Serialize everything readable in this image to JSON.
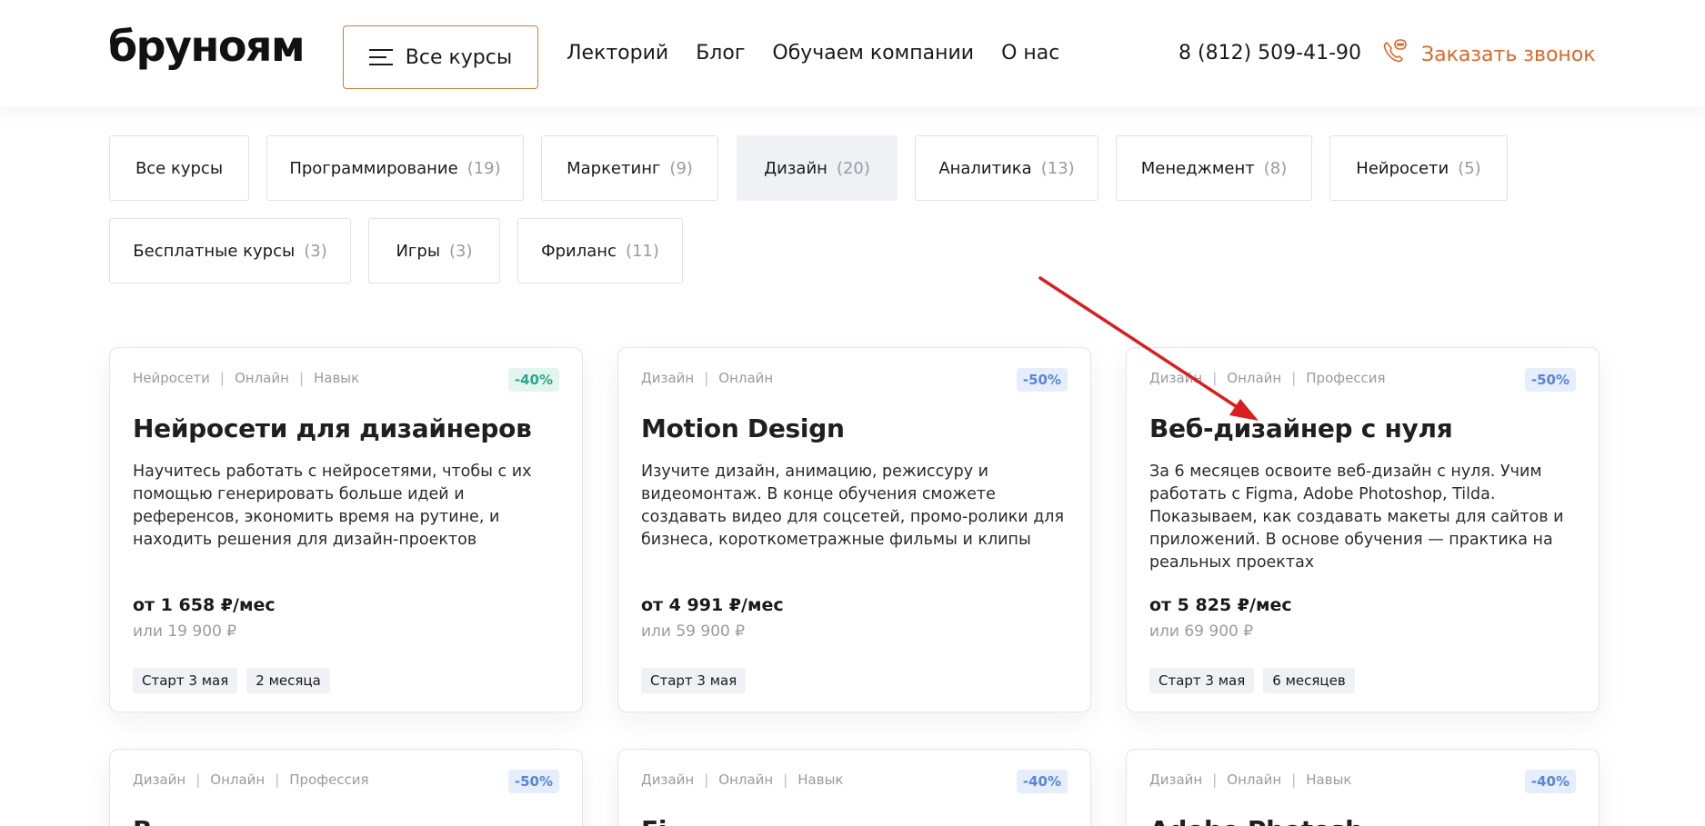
{
  "header": {
    "logo": "бруноям",
    "all_courses_label": "Все курсы",
    "nav": [
      "Лекторий",
      "Блог",
      "Обучаем компании",
      "О нас"
    ],
    "phone": "8 (812) 509-41-90",
    "callback_label": "Заказать звонок"
  },
  "filters": [
    {
      "label": "Все курсы",
      "count": ""
    },
    {
      "label": "Программирование",
      "count": "(19)"
    },
    {
      "label": "Маркетинг",
      "count": "(9)"
    },
    {
      "label": "Дизайн",
      "count": "(20)",
      "active": true
    },
    {
      "label": "Аналитика",
      "count": "(13)"
    },
    {
      "label": "Менеджмент",
      "count": "(8)"
    },
    {
      "label": "Нейросети",
      "count": "(5)"
    },
    {
      "label": "Бесплатные курсы",
      "count": "(3)"
    },
    {
      "label": "Игры",
      "count": "(3)"
    },
    {
      "label": "Фриланс",
      "count": "(11)"
    }
  ],
  "cards": [
    {
      "tags": [
        "Нейросети",
        "Онлайн",
        "Навык"
      ],
      "discount": "-40%",
      "discount_color": "green",
      "title": "Нейросети для дизайнеров",
      "description": "Научитесь работать с нейросетями, чтобы с их помощью генерировать больше идей и референсов, экономить время на рутине, и находить решения для дизайн-проектов",
      "price_monthly": "от 1 658 ₽/мес",
      "price_full": "или 19 900 ₽",
      "pills": [
        "Старт 3 мая",
        "2 месяца"
      ]
    },
    {
      "tags": [
        "Дизайн",
        "Онлайн"
      ],
      "discount": "-50%",
      "discount_color": "blue",
      "title": "Motion Design",
      "description": "Изучите дизайн, анимацию, режиссуру и видеомонтаж. В конце обучения сможете создавать видео для соцсетей, промо-ролики для бизнеса, короткометражные фильмы и клипы",
      "price_monthly": "от 4 991 ₽/мес",
      "price_full": "или 59 900 ₽",
      "pills": [
        "Старт 3 мая"
      ]
    },
    {
      "tags": [
        "Дизайн",
        "Онлайн",
        "Профессия"
      ],
      "discount": "-50%",
      "discount_color": "blue",
      "title": "Веб-дизайнер с нуля",
      "description": "За 6 месяцев освоите веб-дизайн с нуля. Учим работать с Figma, Adobe Photoshop, Tilda. Показываем, как создавать макеты для сайтов и приложений. В основе обучения — практика на реальных проектах",
      "price_monthly": "от 5 825 ₽/мес",
      "price_full": "или 69 900 ₽",
      "pills": [
        "Старт 3 мая",
        "6 месяцев"
      ]
    },
    {
      "tags": [
        "Дизайн",
        "Онлайн",
        "Профессия"
      ],
      "discount": "-50%",
      "discount_color": "blue",
      "title": "В",
      "description": "",
      "price_monthly": "",
      "price_full": "",
      "pills": []
    },
    {
      "tags": [
        "Дизайн",
        "Онлайн",
        "Навык"
      ],
      "discount": "-40%",
      "discount_color": "blue",
      "title": "Fi",
      "description": "",
      "price_monthly": "",
      "price_full": "",
      "pills": []
    },
    {
      "tags": [
        "Дизайн",
        "Онлайн",
        "Навык"
      ],
      "discount": "-40%",
      "discount_color": "blue",
      "title": "Adobe Photosh",
      "description": "",
      "price_monthly": "",
      "price_full": "",
      "pills": []
    }
  ],
  "colors": {
    "accent": "#d9692c",
    "annotation_arrow": "#d81e1e"
  }
}
